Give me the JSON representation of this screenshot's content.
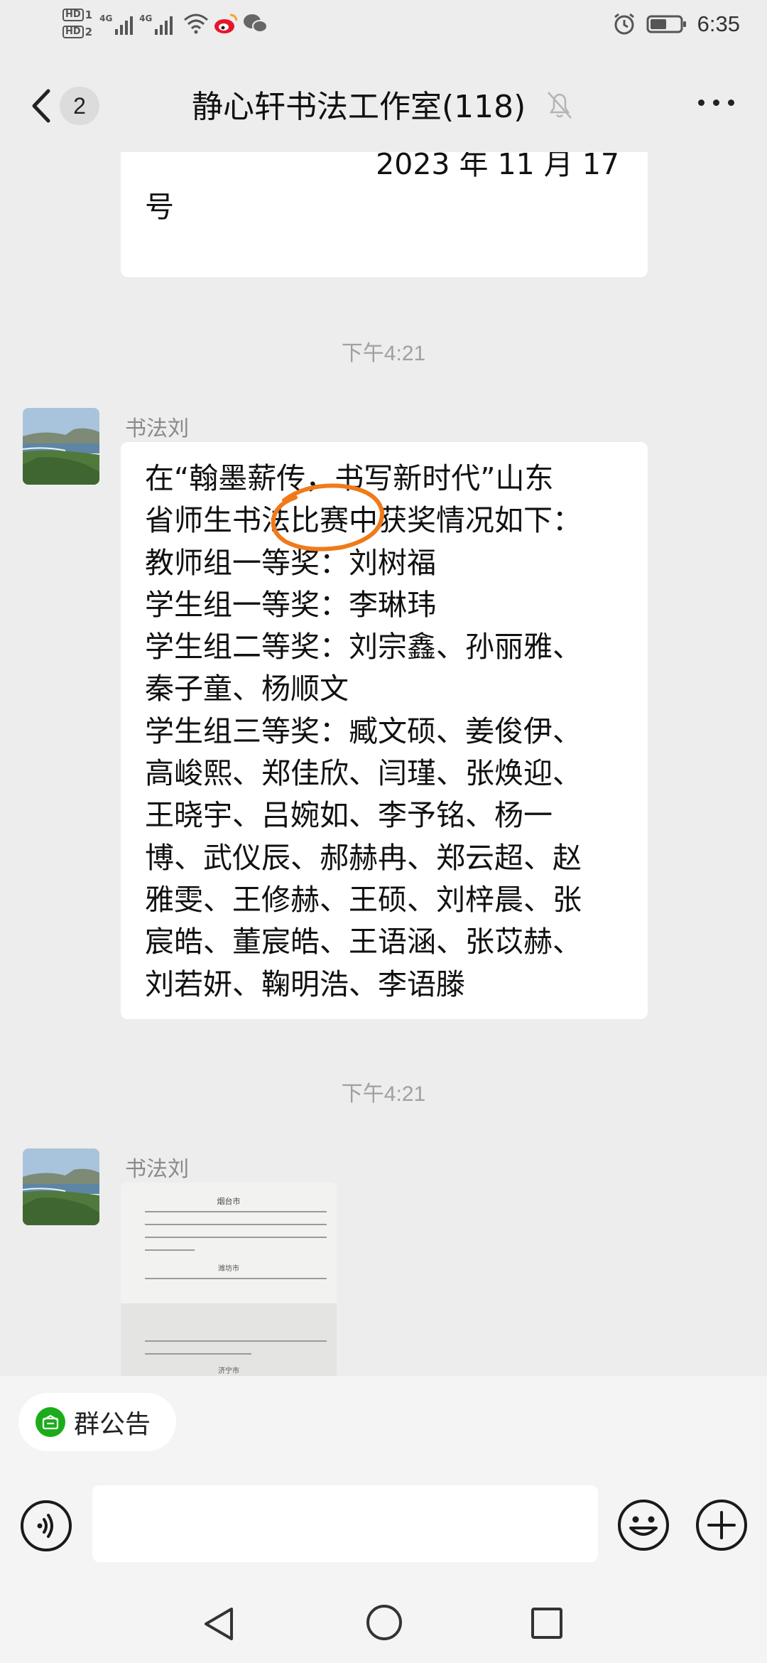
{
  "status_bar": {
    "sim1_tag": "HD",
    "sim1_num": "1",
    "sim2_tag": "HD",
    "sim2_num": "2",
    "network1": "4G",
    "network2": "4G",
    "time": "6:35",
    "icons": [
      "signal-icon",
      "wifi-icon",
      "weibo-icon",
      "wechat-icon",
      "alarm-icon",
      "battery-icon"
    ]
  },
  "header": {
    "unread_count": "2",
    "title": "静心轩书法工作室(118)",
    "icons": [
      "back-icon",
      "mute-icon",
      "more-icon"
    ]
  },
  "messages": {
    "top_bubble": {
      "line1": "2023 年 11 月 17",
      "line2": "号"
    },
    "time1": "下午4:21",
    "msg1": {
      "sender": "书法刘",
      "lines": [
        "在“翰墨薪传，书写新时代”山东",
        "省师生书法比赛中获奖情况如下：",
        "教师组一等奖：刘树福",
        "学生组一等奖：李琳玮",
        "学生组二等奖：刘宗鑫、孙丽雅、",
        "秦子童、杨顺文",
        "学生组三等奖：臧文硕、姜俊伊、",
        "高峻熙、郑佳欣、闫瑾、张焕迎、",
        "王晓宇、吕婉如、李予铭、杨一",
        "博、武仪辰、郝赫冉、郑云超、赵",
        "雅雯、王修赫、王硕、刘梓晨、张",
        "宸皓、董宸皓、王语涵、张苡赫、",
        "刘若妍、鞠明浩、李语滕"
      ]
    },
    "time2": "下午4:21",
    "msg2": {
      "sender": "书法刘",
      "image_heading": "烟台市",
      "image_sub1": "潍坊市",
      "image_sub2": "济宁市"
    }
  },
  "announcement": {
    "label": "群公告"
  },
  "input_bar": {
    "placeholder": "",
    "icons": [
      "voice-icon",
      "emoji-icon",
      "plus-icon"
    ]
  },
  "nav_bar": {
    "icons": [
      "nav-back-icon",
      "nav-home-icon",
      "nav-recent-icon"
    ]
  },
  "colors": {
    "background": "#ededed",
    "bubble": "#ffffff",
    "highlight_circle": "#f07a1a",
    "announcement_icon": "#1aad19"
  }
}
